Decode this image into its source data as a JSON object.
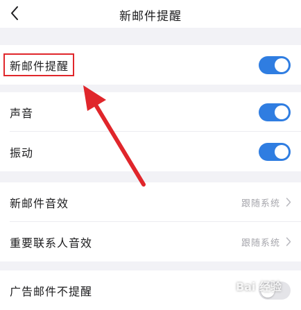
{
  "header": {
    "title": "新邮件提醒",
    "back_icon": "chevron-left-icon"
  },
  "settings": [
    {
      "label": "新邮件提醒",
      "type": "toggle",
      "enabled": true
    },
    {
      "label": "声音",
      "type": "toggle",
      "enabled": true
    },
    {
      "label": "振动",
      "type": "toggle",
      "enabled": true
    },
    {
      "label": "新邮件音效",
      "type": "select",
      "value": "跟随系统"
    },
    {
      "label": "重要联系人音效",
      "type": "select",
      "value": "跟随系统"
    },
    {
      "label": "广告邮件不提醒",
      "type": "toggle",
      "enabled": false
    }
  ],
  "annotation": {
    "highlight_color": "#e0262b",
    "arrow_color": "#e0262b"
  },
  "watermark": {
    "text": "Bai 经验"
  },
  "colors": {
    "toggle_on": "#2f7de1",
    "toggle_off": "#e4e4e8",
    "background": "#f2f2f6"
  }
}
